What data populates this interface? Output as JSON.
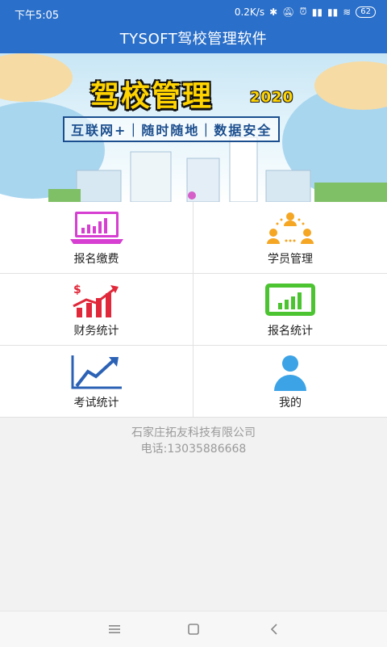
{
  "status_bar": {
    "time": "下午5:05",
    "net_speed": "0.2K/s",
    "battery": "62"
  },
  "app_bar": {
    "title": "TYSOFT驾校管理软件"
  },
  "banner": {
    "title": "驾校管理",
    "year": "2020",
    "tagline": "互联网+｜随时随地｜数据安全"
  },
  "menu": [
    {
      "label": "报名缴费",
      "icon": "laptop-chart-icon"
    },
    {
      "label": "学员管理",
      "icon": "people-group-icon"
    },
    {
      "label": "财务统计",
      "icon": "finance-bars-icon"
    },
    {
      "label": "报名统计",
      "icon": "tablet-bars-icon"
    },
    {
      "label": "考试统计",
      "icon": "trend-line-icon"
    },
    {
      "label": "我的",
      "icon": "user-profile-icon"
    }
  ],
  "footer": {
    "company": "石家庄拓友科技有限公司",
    "phone": "电话:13035886668"
  },
  "colors": {
    "app_bar": "#2a6fc9",
    "footer_text": "#9a9a9a"
  }
}
